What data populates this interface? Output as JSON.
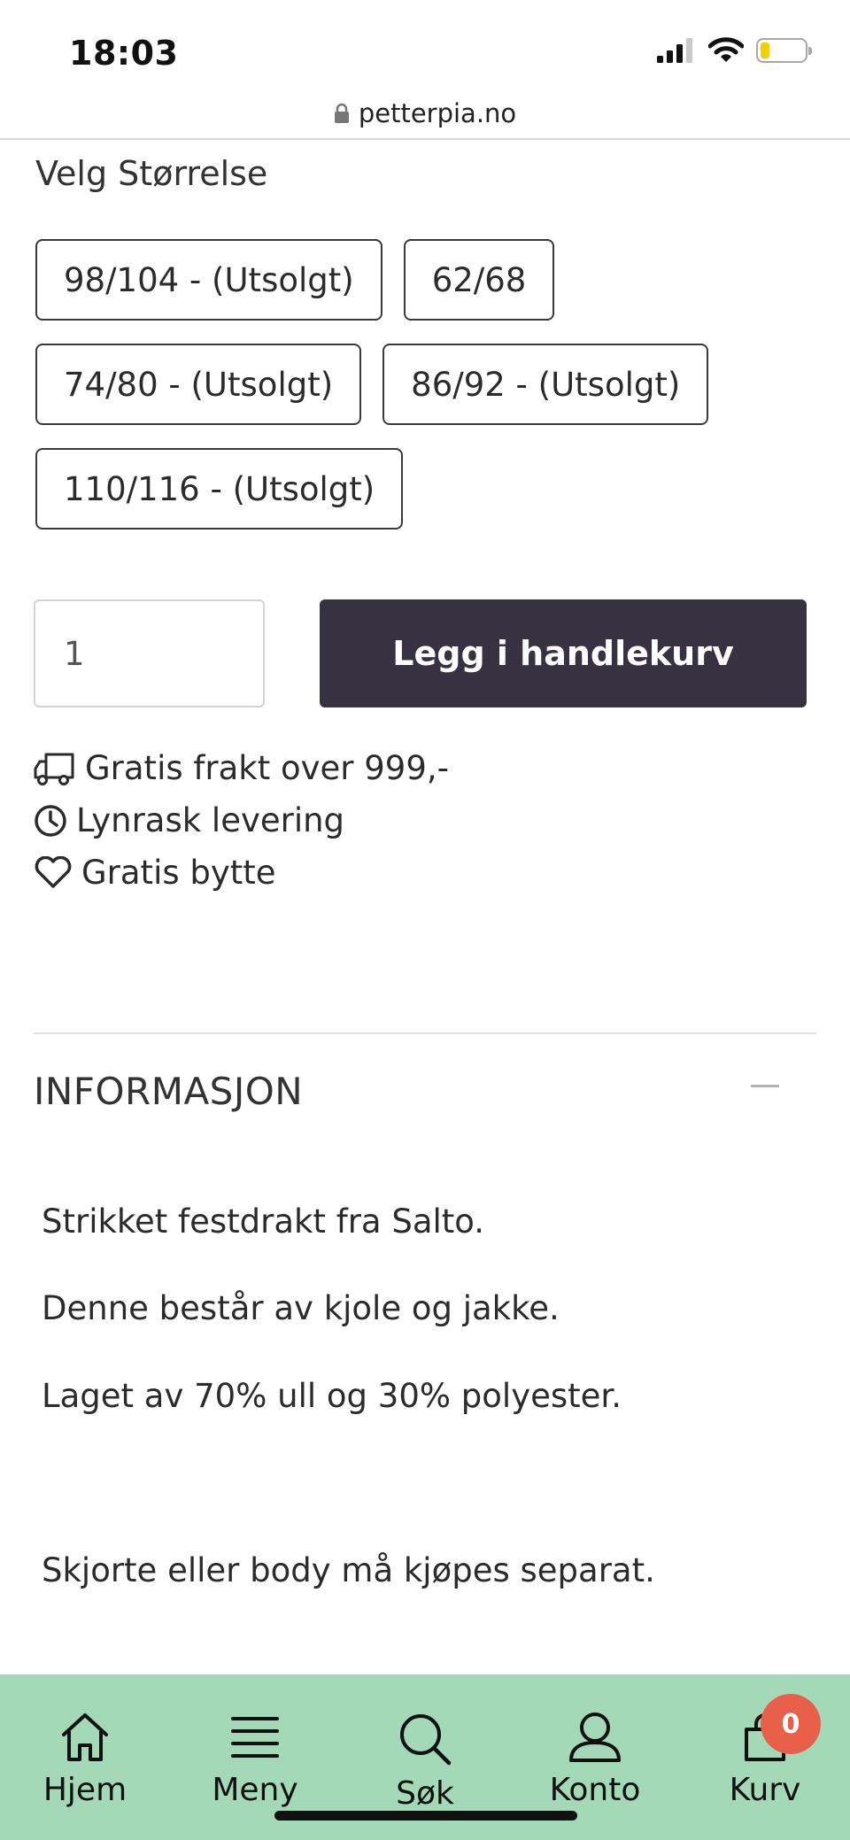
{
  "status_bar": {
    "time": "18:03",
    "battery_level": 0.2
  },
  "browser": {
    "url": "petterpia.no"
  },
  "size_selector": {
    "heading": "Velg Størrelse",
    "options": [
      "98/104 - (Utsolgt)",
      "62/68",
      "74/80 - (Utsolgt)",
      "86/92 - (Utsolgt)",
      "110/116 - (Utsolgt)"
    ]
  },
  "purchase": {
    "quantity": "1",
    "add_to_cart_label": "Legg i handlekurv"
  },
  "perks": [
    {
      "icon": "truck-icon",
      "label": "Gratis frakt over 999,-"
    },
    {
      "icon": "clock-icon",
      "label": "Lynrask levering"
    },
    {
      "icon": "heart-icon",
      "label": "Gratis bytte"
    }
  ],
  "info": {
    "title": "INFORMASJON",
    "paragraphs": [
      "Strikket festdrakt fra Salto.",
      "Denne består av kjole og jakke.",
      "Laget av 70% ull og 30% polyester.",
      "Skjorte eller body må kjøpes separat."
    ]
  },
  "bottom_nav": {
    "items": [
      {
        "icon": "home-icon",
        "label": "Hjem"
      },
      {
        "icon": "menu-icon",
        "label": "Meny"
      },
      {
        "icon": "search-icon",
        "label": "Søk"
      },
      {
        "icon": "user-icon",
        "label": "Konto"
      },
      {
        "icon": "cart-icon",
        "label": "Kurv"
      }
    ],
    "cart_count": "0"
  },
  "colors": {
    "nav_background": "#a3d9b7",
    "button_dark": "#363241",
    "badge": "#e8604a"
  }
}
